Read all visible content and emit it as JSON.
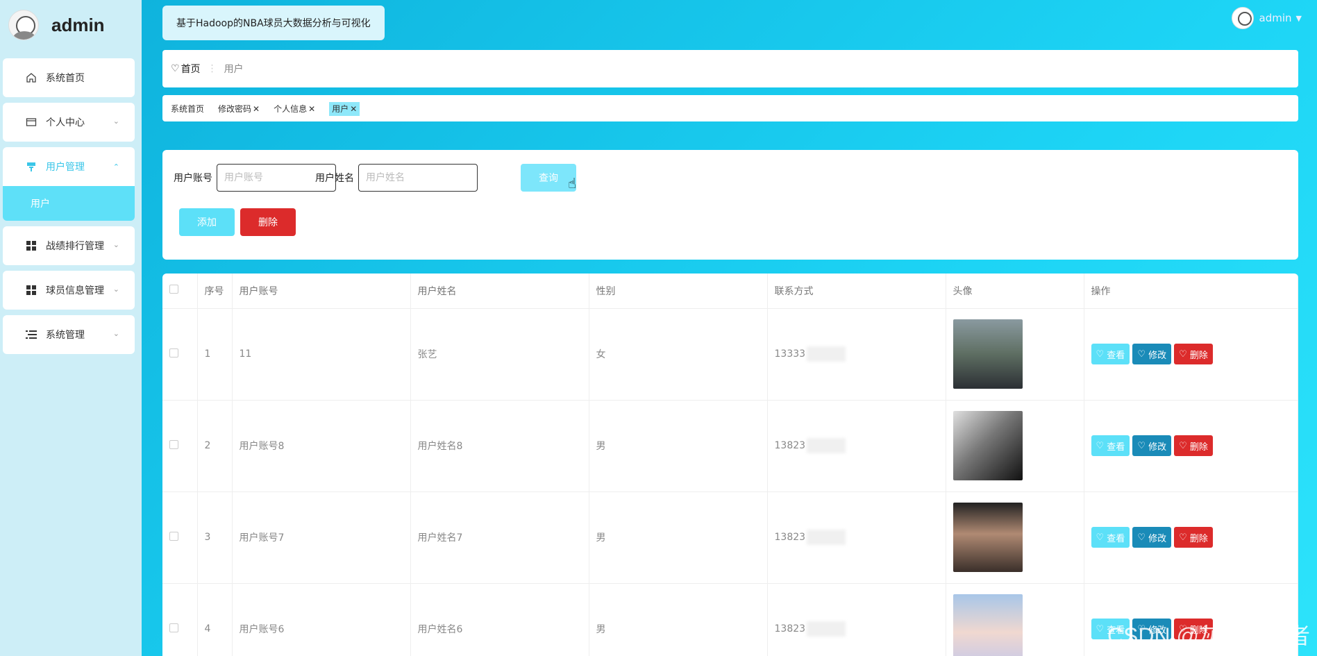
{
  "app": {
    "brand": "admin",
    "title": "基于Hadoop的NBA球员大数据分析与可视化",
    "user": "admin"
  },
  "sidebar": {
    "items": [
      {
        "label": "系统首页",
        "icon": "home-icon"
      },
      {
        "label": "个人中心",
        "icon": "card-icon"
      },
      {
        "label": "用户管理",
        "icon": "user-manage-icon",
        "expanded": true,
        "sub": "用户"
      },
      {
        "label": "战绩排行管理",
        "icon": "grid-icon"
      },
      {
        "label": "球员信息管理",
        "icon": "grid-icon"
      },
      {
        "label": "系统管理",
        "icon": "list-icon"
      }
    ]
  },
  "breadcrumb": {
    "home": "首页",
    "current": "用户"
  },
  "tabs": [
    {
      "label": "系统首页",
      "closable": false
    },
    {
      "label": "修改密码",
      "closable": true
    },
    {
      "label": "个人信息",
      "closable": true
    },
    {
      "label": "用户",
      "closable": true,
      "active": true
    }
  ],
  "search": {
    "account_label": "用户账号",
    "account_placeholder": "用户账号",
    "name_label": "用户姓名",
    "name_placeholder": "用户姓名",
    "query": "查询",
    "add": "添加",
    "delete": "删除"
  },
  "table": {
    "columns": [
      "序号",
      "用户账号",
      "用户姓名",
      "性别",
      "联系方式",
      "头像",
      "操作"
    ],
    "rows": [
      {
        "index": "1",
        "account": "11",
        "name": "张艺",
        "gender": "女",
        "phone": "13333"
      },
      {
        "index": "2",
        "account": "用户账号8",
        "name": "用户姓名8",
        "gender": "男",
        "phone": "13823"
      },
      {
        "index": "3",
        "account": "用户账号7",
        "name": "用户姓名7",
        "gender": "男",
        "phone": "13823"
      },
      {
        "index": "4",
        "account": "用户账号6",
        "name": "用户姓名6",
        "gender": "男",
        "phone": "13823"
      }
    ],
    "actions": {
      "view": "查看",
      "edit": "修改",
      "delete": "删除"
    }
  },
  "watermark": "CSDN @灰灬编程者",
  "colors": {
    "accent": "#5ce0f8",
    "edit": "#1a8bb8",
    "danger": "#dc2b2b"
  }
}
